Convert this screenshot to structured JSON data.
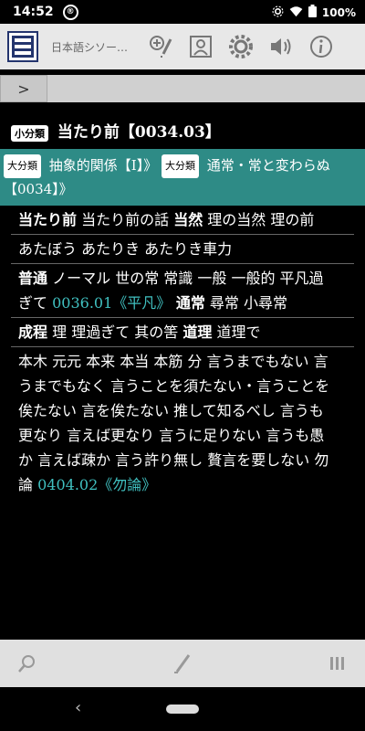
{
  "status": {
    "time": "14:52",
    "dnd": "®",
    "battery": "100%"
  },
  "toolbar": {
    "title": "日本語シソー…"
  },
  "nav": {
    "arrow": ">"
  },
  "heading": {
    "badge": "小分類",
    "title": "当たり前【0034.03】"
  },
  "category": {
    "badge1": "大分類",
    "text1": "抽象的関係【Ⅰ】》",
    "badge2": "大分類",
    "text2": "通常・常と変わらぬ【0034】》"
  },
  "entries": [
    {
      "bold": "当たり前",
      "text": " 当たり前の話 ",
      "bold2": "当然",
      "text2": " 理の当然 理の前"
    },
    {
      "text": "あたぼう あたりき あたりき車力"
    },
    {
      "bold": "普通",
      "text": " ノーマル 世の常 常識 一般 一般的 平凡過ぎて ",
      "link": "0036.01《平凡》",
      "bold2": " 通常",
      "text2": " 尋常 小尋常"
    },
    {
      "bold": "成程",
      "text": " 理 理過ぎて 其の筈 ",
      "bold2": "道理",
      "text2": " 道理で"
    },
    {
      "text": "本木 元元 本来 本当 本筋 分 言うまでもない 言うまでもなく 言うことを須たない・言うことを俟たない 言を俟たない 推して知るべし 言うも更なり 言えば更なり 言うに足りない 言うも愚か 言えば疎か 言う許り無し 贅言を要しない 勿論 ",
      "link": "0404.02《勿論》"
    }
  ],
  "colors": {
    "accent": "#2e8b86",
    "link": "#40c0c0",
    "app_icon": "#24356e"
  },
  "icons": {
    "toolbar": [
      "app-icon",
      "zoom-in-icon",
      "pen-icon",
      "portrait-icon",
      "gear-icon",
      "speaker-icon",
      "info-icon"
    ],
    "bottom": [
      "search-icon",
      "pen-icon",
      "menu-icon"
    ],
    "system": [
      "back-icon",
      "home-icon"
    ]
  }
}
